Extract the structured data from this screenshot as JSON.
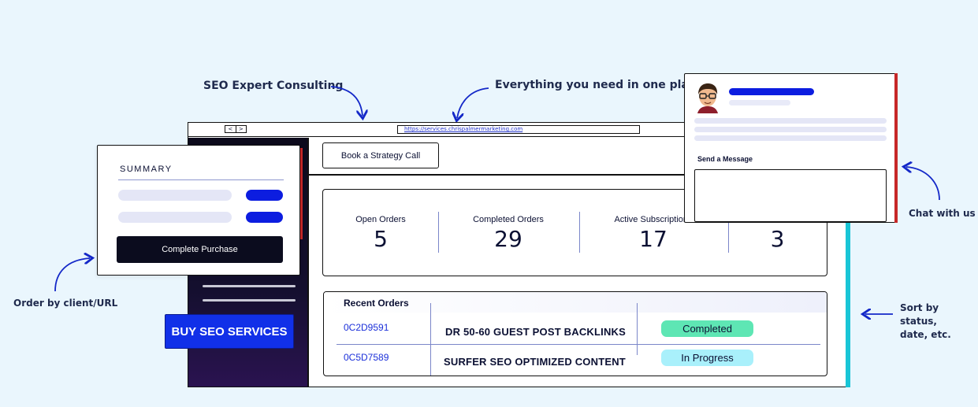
{
  "annotations": {
    "seo_expert": "SEO Expert Consulting",
    "everything": "Everything you need in one place !",
    "chat_with_us": "Chat with us",
    "order_by": "Order by client/URL",
    "sort_by_line1": "Sort by status,",
    "sort_by_line2": "date, etc."
  },
  "browser": {
    "back_icon": "<",
    "forward_icon": ">",
    "url": "https://services.chrispalmermarketing.com"
  },
  "sidebar": {
    "buy_button": "BUY SEO SERVICES"
  },
  "header": {
    "strategy_button": "Book a Strategy Call"
  },
  "stats": [
    {
      "label": "Open Orders",
      "value": "5"
    },
    {
      "label": "Completed Orders",
      "value": "29"
    },
    {
      "label": "Active Subscriptions",
      "value": "17"
    },
    {
      "label": "",
      "value": "3"
    }
  ],
  "orders": {
    "title": "Recent Orders",
    "rows": [
      {
        "id": "0C2D9591",
        "service": "DR 50-60 GUEST POST BACKLINKS",
        "status": "Completed"
      },
      {
        "id": "0C5D7589",
        "service": "SURFER SEO OPTIMIZED CONTENT",
        "status": "In Progress"
      }
    ]
  },
  "summary": {
    "title": "SUMMARY",
    "purchase_button": "Complete Purchase"
  },
  "chat": {
    "send_label": "Send a Message"
  },
  "colors": {
    "background": "#eaf6fd",
    "primary_blue": "#1130e8",
    "completed_badge": "#5ee6b4",
    "in_progress_badge": "#a9f0fb",
    "accent_red": "#c62828",
    "accent_cyan": "#19c5d6"
  }
}
